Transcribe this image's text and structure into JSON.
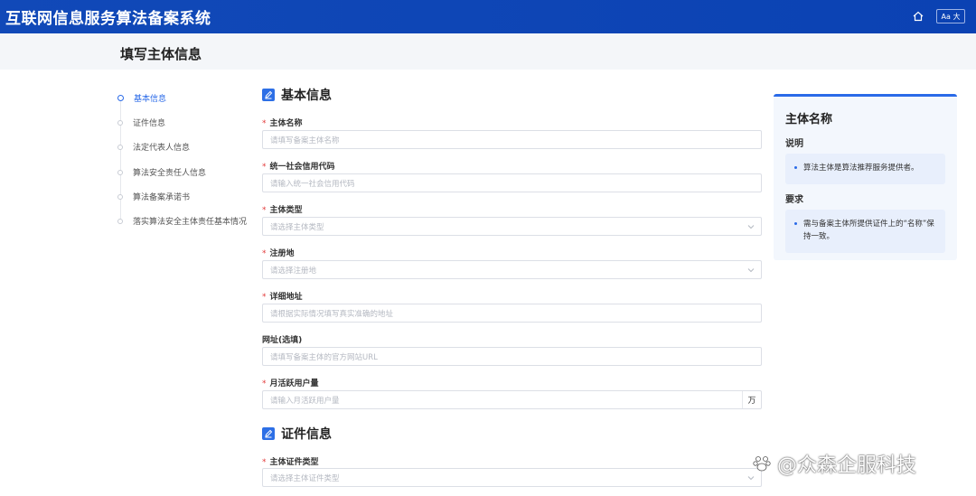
{
  "app": {
    "title": "互联网信息服务算法备案系统",
    "font_toggle": "Aa 大",
    "brand_color": "#1149b8",
    "accent_color": "#2a6ae8"
  },
  "page": {
    "title": "填写主体信息"
  },
  "steps": [
    {
      "label": "基本信息",
      "active": true
    },
    {
      "label": "证件信息",
      "active": false
    },
    {
      "label": "法定代表人信息",
      "active": false
    },
    {
      "label": "算法安全责任人信息",
      "active": false
    },
    {
      "label": "算法备案承诺书",
      "active": false
    },
    {
      "label": "落实算法安全主体责任基本情况",
      "active": false
    }
  ],
  "sections": {
    "basic": {
      "title": "基本信息"
    },
    "cert": {
      "title": "证件信息"
    }
  },
  "fields": [
    {
      "label": "主体名称",
      "required": true,
      "placeholder": "请填写备案主体名称",
      "type": "text"
    },
    {
      "label": "统一社会信用代码",
      "required": true,
      "placeholder": "请输入统一社会信用代码",
      "type": "text"
    },
    {
      "label": "主体类型",
      "required": true,
      "placeholder": "请选择主体类型",
      "type": "select"
    },
    {
      "label": "注册地",
      "required": true,
      "placeholder": "请选择注册地",
      "type": "select"
    },
    {
      "label": "详细地址",
      "required": true,
      "placeholder": "请根据实际情况填写真实准确的地址",
      "type": "text"
    },
    {
      "label": "网址(选填)",
      "required": false,
      "placeholder": "请填写备案主体的官方网站URL",
      "type": "text"
    },
    {
      "label": "月活跃用户量",
      "required": true,
      "placeholder": "请输入月活跃用户量",
      "type": "text",
      "suffix": "万"
    }
  ],
  "cert_fields": [
    {
      "label": "主体证件类型",
      "required": true,
      "placeholder": "请选择主体证件类型",
      "type": "select"
    }
  ],
  "info_card": {
    "title": "主体名称",
    "explain_heading": "说明",
    "explain_text": "算法主体是算法推荐服务提供者。",
    "require_heading": "要求",
    "require_text": "需与备案主体所提供证件上的“名称”保持一致。"
  },
  "watermark": {
    "text": "@众森企服科技"
  },
  "icons": {
    "home": "home-icon",
    "section": "edit-icon",
    "dropdown": "chevron-down-icon"
  }
}
